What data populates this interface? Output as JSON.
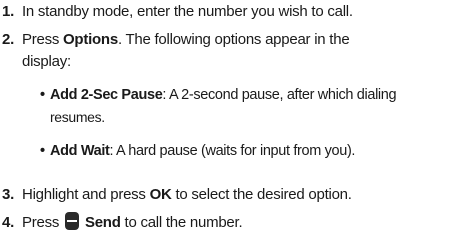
{
  "steps": [
    {
      "number": "1.",
      "text": "In standby mode, enter the number you wish to call."
    },
    {
      "number": "2.",
      "pre": "Press ",
      "bold": "Options",
      "post": ". The following options appear in the",
      "line2": "display:"
    },
    {
      "number": "3.",
      "pre": "Highlight and press ",
      "bold": "OK",
      "post": " to select the desired option."
    },
    {
      "number": "4.",
      "pre": "Press ",
      "icon": "send-key-icon",
      "bold": "Send",
      "post": " to call the number."
    }
  ],
  "bullets": [
    {
      "bold": "Add 2-Sec Pause",
      "text": ": A 2-second pause, after which dialing",
      "continuation": "resumes."
    },
    {
      "bold": "Add Wait",
      "text": ": A hard pause (waits for input from you)."
    }
  ],
  "bullet_char": "•"
}
